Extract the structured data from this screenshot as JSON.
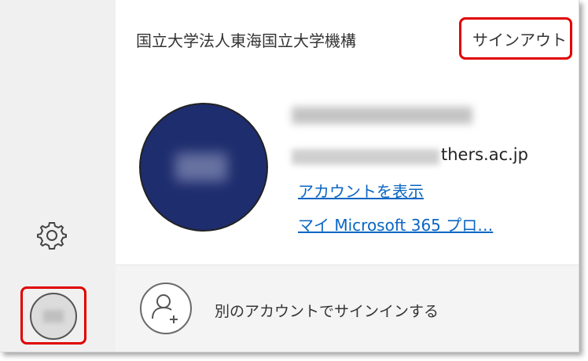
{
  "sidebar": {
    "settings_icon": "gear-icon",
    "account_icon": "avatar"
  },
  "account": {
    "organization": "国立大学法人東海国立大学機構",
    "sign_out_label": "サインアウト",
    "email_visible_suffix": "thers.ac.jp",
    "view_account_link": "アカウントを表示",
    "profile_link": "マイ Microsoft 365 プロ…"
  },
  "other_account": {
    "label": "別のアカウントでサインインする",
    "icon": "add-person-icon"
  },
  "colors": {
    "highlight": "#e00000",
    "link": "#0a66c2",
    "avatar_bg": "#1e2d6e"
  }
}
